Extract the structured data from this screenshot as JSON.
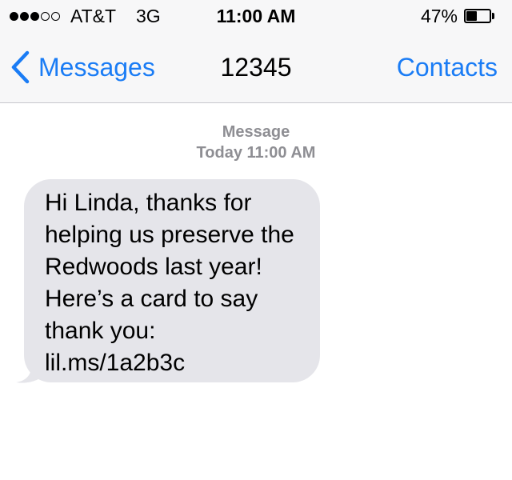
{
  "status_bar": {
    "signal_bars_filled": 3,
    "signal_bars_total": 5,
    "carrier": "AT&T",
    "network": "3G",
    "time": "11:00 AM",
    "battery_percent": "47%",
    "battery_level": 0.47
  },
  "nav_bar": {
    "back_label": "Messages",
    "title": "12345",
    "right_label": "Contacts"
  },
  "thread": {
    "service_label": "Message",
    "timestamp": "Today 11:00 AM"
  },
  "messages": [
    {
      "direction": "incoming",
      "lines": [
        "Hi Linda, thanks for",
        "helping us preserve the",
        "Redwoods last year!",
        "Here’s a card to say",
        "thank you:",
        "lil.ms/1a2b3c"
      ]
    }
  ],
  "colors": {
    "accent": "#1a7cf5",
    "incoming_bubble": "#e5e5ea",
    "muted_text": "#8e8e93",
    "header_bg": "#f7f7f8"
  }
}
